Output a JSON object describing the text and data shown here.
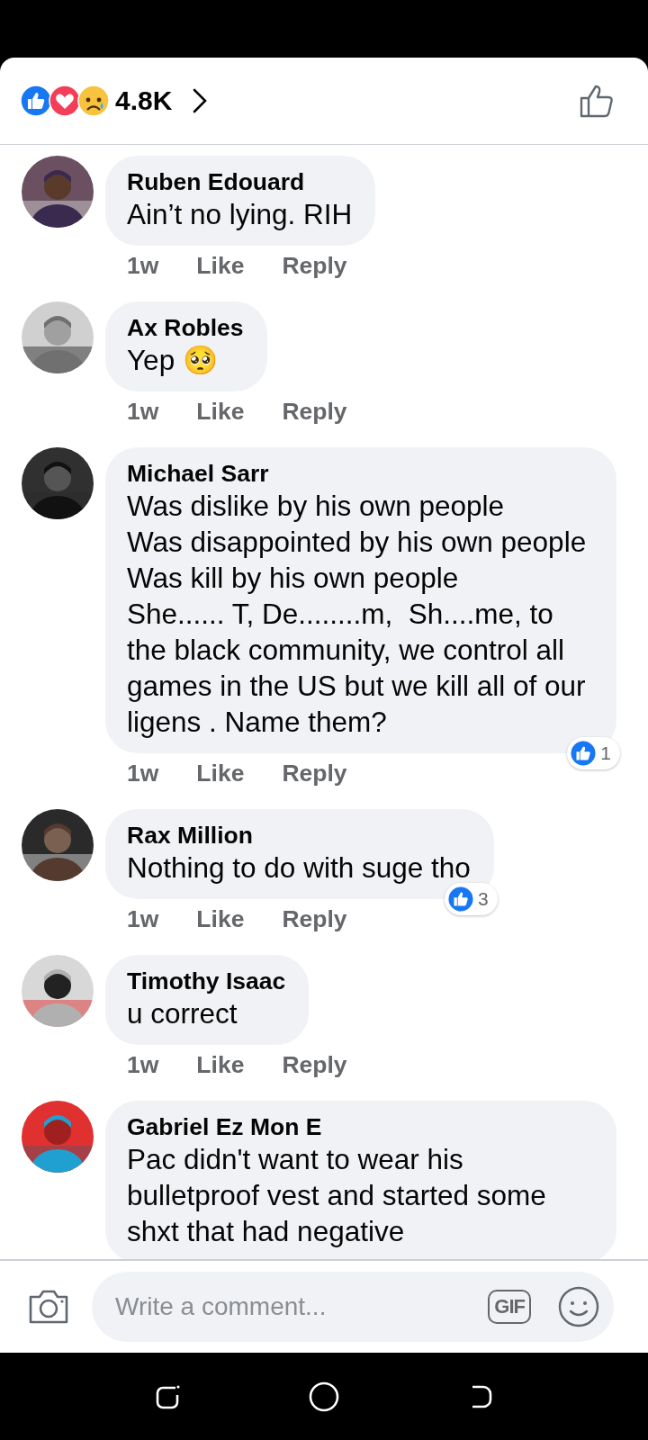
{
  "reactions_summary": {
    "count": "4.8K"
  },
  "comments": [
    {
      "author": "Ruben Edouard",
      "text": "Ain’t no lying. RIH",
      "time": "1w",
      "like": "Like",
      "reply": "Reply"
    },
    {
      "author": "Ax Robles",
      "text": "Yep 🥺",
      "time": "1w",
      "like": "Like",
      "reply": "Reply"
    },
    {
      "author": "Michael Sarr",
      "text": "Was dislike by his own people\nWas disappointed by his own people\nWas kill by his own people\nShe...... T, De........m,  Sh....me, to the black community, we control all games in the US but we kill all of our ligens . Name them?",
      "time": "1w",
      "like": "Like",
      "reply": "Reply",
      "reaction_count": "1"
    },
    {
      "author": "Rax Million",
      "text": "Nothing to do with suge tho",
      "time": "1w",
      "like": "Like",
      "reply": "Reply",
      "reaction_count": "3"
    },
    {
      "author": "Timothy Isaac",
      "text": "u correct",
      "time": "1w",
      "like": "Like",
      "reply": "Reply"
    },
    {
      "author": "Gabriel Ez Mon E",
      "text": "Pac didn't want to wear his bulletproof vest and started some shxt that had negative"
    }
  ],
  "composer": {
    "placeholder": "Write a comment...",
    "gif_label": "GIF"
  }
}
